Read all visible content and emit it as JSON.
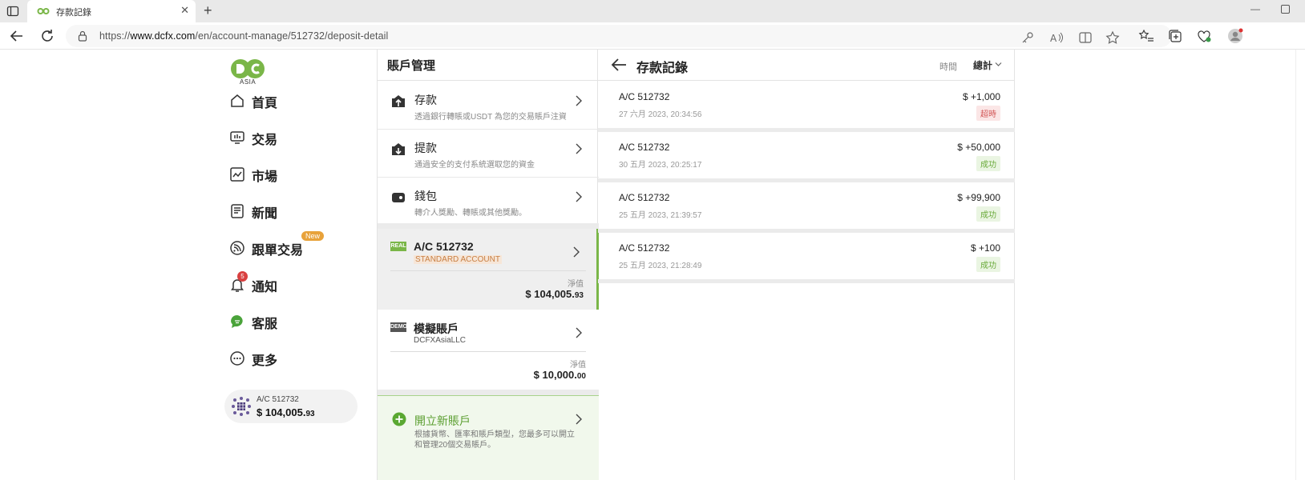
{
  "browser": {
    "tab_title": "存款記錄",
    "url_prefix": "https://",
    "url_host": "www.dcfx.com",
    "url_path": "/en/account-manage/512732/deposit-detail"
  },
  "logo": {
    "sub": "ASIA"
  },
  "nav": {
    "items": [
      {
        "label": "首頁"
      },
      {
        "label": "交易"
      },
      {
        "label": "市場"
      },
      {
        "label": "新聞"
      },
      {
        "label": "跟單交易"
      },
      {
        "label": "通知"
      },
      {
        "label": "客服"
      },
      {
        "label": "更多"
      }
    ],
    "new_badge": "New",
    "notif_count": "5",
    "account": {
      "number": "A/C 512732",
      "balance_main": "$ 104,005.",
      "balance_cents": "93"
    }
  },
  "account_panel": {
    "title": "賬戶管理",
    "menu": [
      {
        "title": "存款",
        "sub": "透過銀行轉賬或USDT 為您的交易賬戶注資"
      },
      {
        "title": "提款",
        "sub": "通過安全的支付系統選取您的資金"
      },
      {
        "title": "錢包",
        "sub": "轉介人獎勵、轉賬或其他獎勵。"
      }
    ],
    "real": {
      "tag": "REAL",
      "number": "A/C 512732",
      "type": "STANDARD ACCOUNT",
      "nv_label": "淨值",
      "nv_main": "$ 104,005.",
      "nv_cents": "93"
    },
    "demo": {
      "tag": "DEMO",
      "number": "模擬賬戶",
      "type": "DCFXAsiaLLC",
      "nv_label": "淨值",
      "nv_main": "$ 10,000.",
      "nv_cents": "00"
    },
    "open": {
      "title": "開立新賬戶",
      "desc": "根據貨幣、匯率和賬戶類型，您最多可以開立和管理20個交易賬戶。"
    }
  },
  "deposit": {
    "title": "存款記錄",
    "filter_label": "時間",
    "filter_value": "總計",
    "records": [
      {
        "account": "A/C 512732",
        "time": "27 六月 2023, 20:34:56",
        "amount": "$ +1,000",
        "status": "超時",
        "kind": "timeout"
      },
      {
        "account": "A/C 512732",
        "time": "30 五月 2023, 20:25:17",
        "amount": "$ +50,000",
        "status": "成功",
        "kind": "ok"
      },
      {
        "account": "A/C 512732",
        "time": "25 五月 2023, 21:39:57",
        "amount": "$ +99,900",
        "status": "成功",
        "kind": "ok"
      },
      {
        "account": "A/C 512732",
        "time": "25 五月 2023, 21:28:49",
        "amount": "$ +100",
        "status": "成功",
        "kind": "ok"
      }
    ]
  }
}
